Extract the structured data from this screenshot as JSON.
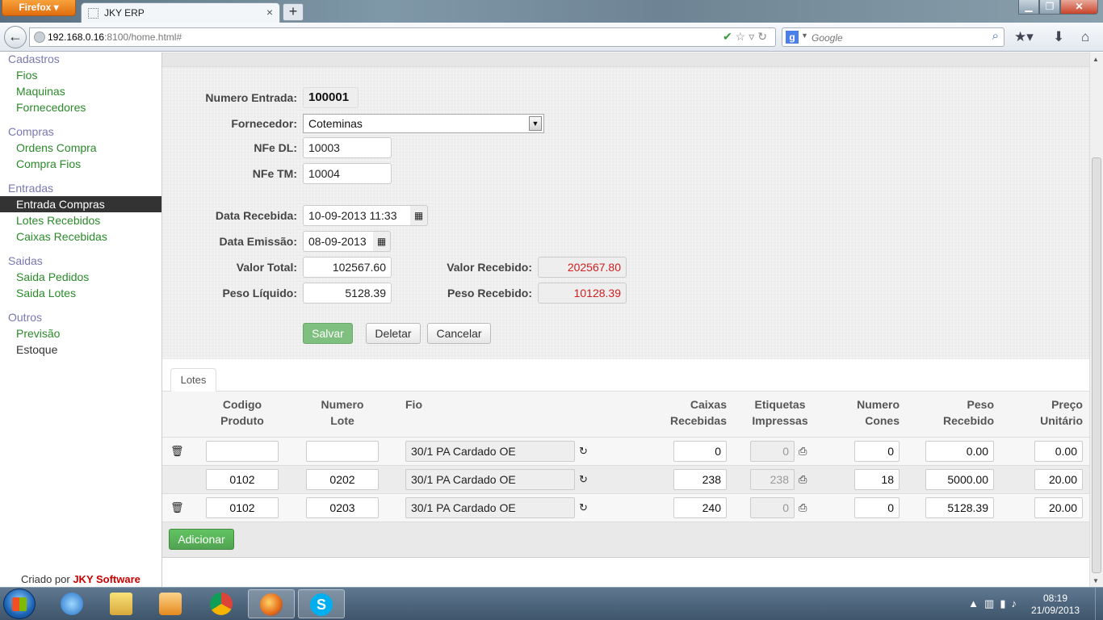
{
  "browser": {
    "app_button": "Firefox",
    "tab_title": "JKY ERP",
    "url_host": "192.168.0.16",
    "url_rest": ":8100/home.html#",
    "search_placeholder": "Google",
    "search_engine_icon": "g-icon"
  },
  "sidebar": {
    "groups": [
      {
        "label": "Cadastros",
        "items": [
          "Fios",
          "Maquinas",
          "Fornecedores"
        ]
      },
      {
        "label": "Compras",
        "items": [
          "Ordens Compra",
          "Compra Fios"
        ]
      },
      {
        "label": "Entradas",
        "items": [
          "Entrada Compras",
          "Lotes Recebidos",
          "Caixas Recebidas"
        ]
      },
      {
        "label": "Saidas",
        "items": [
          "Saida Pedidos",
          "Saida Lotes"
        ]
      },
      {
        "label": "Outros",
        "items": [
          "Previsão",
          "Estoque"
        ]
      }
    ],
    "active_item": "Entrada Compras",
    "credits_prefix": "Criado por",
    "credits_brand": "JKY Software"
  },
  "form": {
    "numero_entrada_label": "Numero Entrada:",
    "numero_entrada_value": "100001",
    "fornecedor_label": "Fornecedor:",
    "fornecedor_value": "Coteminas",
    "nfe_dl_label": "NFe DL:",
    "nfe_dl_value": "10003",
    "nfe_tm_label": "NFe TM:",
    "nfe_tm_value": "10004",
    "data_recebida_label": "Data Recebida:",
    "data_recebida_value": "10-09-2013 11:33",
    "data_emissao_label": "Data Emissão:",
    "data_emissao_value": "08-09-2013",
    "valor_total_label": "Valor Total:",
    "valor_total_value": "102567.60",
    "peso_liquido_label": "Peso Líquido:",
    "peso_liquido_value": "5128.39",
    "valor_recebido_label": "Valor Recebido:",
    "valor_recebido_value": "202567.80",
    "peso_recebido_label": "Peso Recebido:",
    "peso_recebido_value": "10128.39",
    "buttons": {
      "save": "Salvar",
      "delete": "Deletar",
      "cancel": "Cancelar"
    }
  },
  "tabs": {
    "lotes": "Lotes"
  },
  "grid": {
    "headers": {
      "codigo_1": "Codigo",
      "codigo_2": "Produto",
      "lote_1": "Numero",
      "lote_2": "Lote",
      "fio": "Fio",
      "caixas_1": "Caixas",
      "caixas_2": "Recebidas",
      "etiq_1": "Etiquetas",
      "etiq_2": "Impressas",
      "cones_1": "Numero",
      "cones_2": "Cones",
      "peso_1": "Peso",
      "peso_2": "Recebido",
      "preco_1": "Preço",
      "preco_2": "Unitário"
    },
    "rows": [
      {
        "codigo": "",
        "lote": "",
        "fio": "30/1 PA Cardado OE",
        "caixas": "0",
        "etiquetas": "0",
        "cones": "0",
        "peso": "0.00",
        "preco": "0.00"
      },
      {
        "codigo": "0102",
        "lote": "0202",
        "fio": "30/1 PA Cardado OE",
        "caixas": "238",
        "etiquetas": "238",
        "cones": "18",
        "peso": "5000.00",
        "preco": "20.00"
      },
      {
        "codigo": "0102",
        "lote": "0203",
        "fio": "30/1 PA Cardado OE",
        "caixas": "240",
        "etiquetas": "0",
        "cones": "0",
        "peso": "5128.39",
        "preco": "20.00"
      }
    ],
    "add_button": "Adicionar"
  },
  "taskbar": {
    "apps": [
      "internet-explorer",
      "file-explorer",
      "media-player",
      "chrome",
      "firefox",
      "skype"
    ],
    "active_app": "firefox",
    "clock_time": "08:19",
    "clock_date": "21/09/2013"
  },
  "colors": {
    "sidebar_group": "#7878b0",
    "sidebar_link": "#2a8a2a",
    "warning_red": "#d02020",
    "save_green": "#7fbf7f",
    "add_green": "#5bb75b"
  }
}
